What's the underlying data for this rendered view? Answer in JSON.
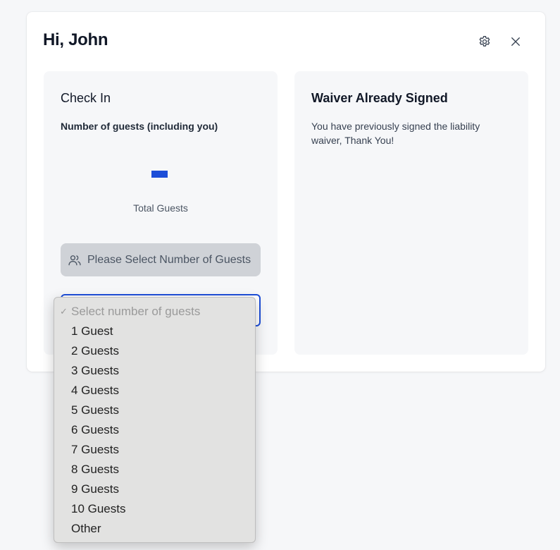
{
  "header": {
    "greeting": "Hi, John"
  },
  "checkin": {
    "title": "Check In",
    "guests_label": "Number of guests (including you)",
    "total_label": "Total Guests",
    "select_button_label": "Please Select Number of Guests"
  },
  "waiver": {
    "title": "Waiver Already Signed",
    "message": "You have previously signed the liability waiver, Thank You!"
  },
  "dropdown": {
    "placeholder": "Select number of guests",
    "options": [
      "1 Guest",
      "2 Guests",
      "3 Guests",
      "4 Guests",
      "5 Guests",
      "6 Guests",
      "7 Guests",
      "8 Guests",
      "9 Guests",
      "10 Guests",
      "Other"
    ]
  },
  "colors": {
    "accent": "#1d4ed8",
    "disabled_button": "#cfd2d7",
    "panel_bg": "#f6f7f9"
  },
  "icons": [
    "gear-icon",
    "close-icon",
    "users-icon",
    "checkmark-icon"
  ]
}
